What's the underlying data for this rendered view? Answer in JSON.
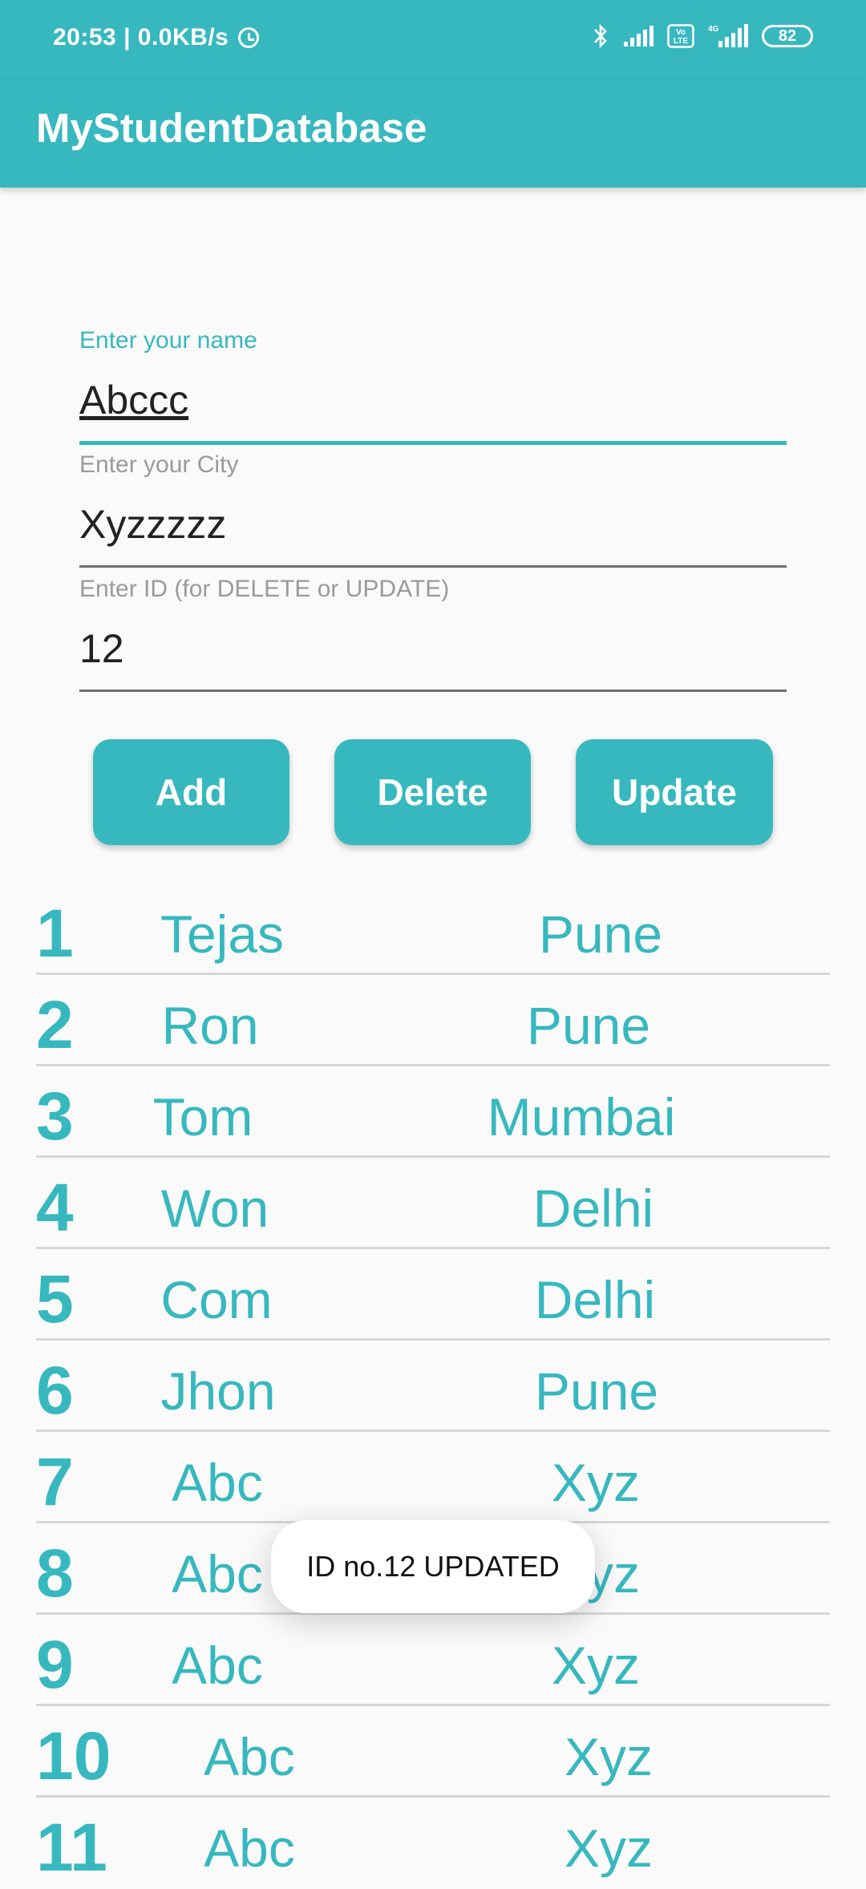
{
  "status_bar": {
    "time_speed": "20:53 | 0.0KB/s",
    "battery": "82",
    "icons": [
      "alarm-icon",
      "bluetooth-icon",
      "signal-icon",
      "volte-icon",
      "4g-signal-icon",
      "battery-icon"
    ]
  },
  "app_bar": {
    "title": "MyStudentDatabase"
  },
  "form": {
    "name_label": "Enter your name",
    "name_value": "Abccc",
    "city_label": "Enter your City",
    "city_value": "Xyzzzzz",
    "id_label": "Enter ID (for DELETE or UPDATE)",
    "id_value": "12"
  },
  "buttons": {
    "add": "Add",
    "delete": "Delete",
    "update": "Update"
  },
  "students": [
    {
      "id": "1",
      "name": "Tejas",
      "city": "Pune"
    },
    {
      "id": "2",
      "name": "Ron",
      "city": "Pune"
    },
    {
      "id": "3",
      "name": "Tom",
      "city": "Mumbai"
    },
    {
      "id": "4",
      "name": "Won",
      "city": "Delhi"
    },
    {
      "id": "5",
      "name": "Com",
      "city": "Delhi"
    },
    {
      "id": "6",
      "name": "Jhon",
      "city": "Pune"
    },
    {
      "id": "7",
      "name": "Abc",
      "city": "Xyz"
    },
    {
      "id": "8",
      "name": "Abc",
      "city": "Xyz"
    },
    {
      "id": "9",
      "name": "Abc",
      "city": "Xyz"
    },
    {
      "id": "10",
      "name": "Abc",
      "city": "Xyz"
    },
    {
      "id": "11",
      "name": "Abc",
      "city": "Xyz"
    }
  ],
  "toast": {
    "message": "ID no.12 UPDATED"
  },
  "colors": {
    "accent": "#37b8bf",
    "background": "#fafafa"
  }
}
